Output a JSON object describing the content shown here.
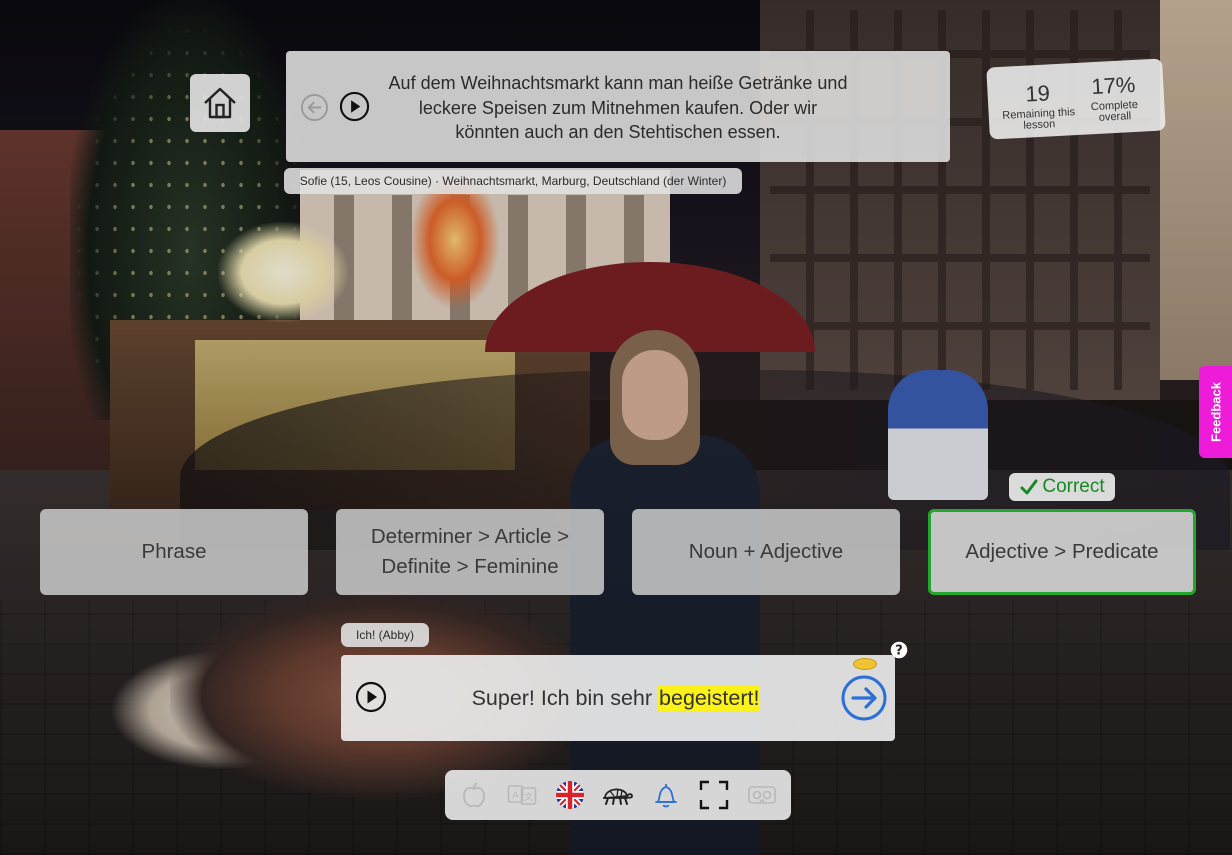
{
  "prompt": {
    "text": "Auf dem Weihnachtsmarkt kann man heiße Getränke und leckere Speisen zum Mitnehmen kaufen. Oder wir könnten auch an den Stehtischen essen.",
    "speaker": "Sofie (15, Leos Cousine) · Weihnachtsmarkt, Marburg, Deutschland (der Winter)"
  },
  "stats": {
    "remaining_value": "19",
    "remaining_label": "Remaining this lesson",
    "complete_value": "17%",
    "complete_label": "Complete overall"
  },
  "answers": [
    {
      "label": "Phrase"
    },
    {
      "label": "Determiner > Article > Definite > Feminine"
    },
    {
      "label": "Noun + Adjective"
    },
    {
      "label": "Adjective > Predicate"
    }
  ],
  "correct_label": "Correct",
  "response": {
    "speaker": "Ich! (Abby)",
    "text_before": "Super! Ich bin sehr",
    "text_highlight": "begeistert!"
  },
  "feedback_label": "Feedback",
  "toolbar": {
    "icons": [
      "apple-icon",
      "translate-icon",
      "uk-flag-icon",
      "turtle-icon",
      "bell-icon",
      "fullscreen-icon",
      "vr-headset-icon"
    ]
  },
  "colors": {
    "correct_green": "#22a62e",
    "highlight_yellow": "#fbf21a",
    "feedback_magenta": "#ee1bd9",
    "next_blue": "#2c6fd6"
  }
}
